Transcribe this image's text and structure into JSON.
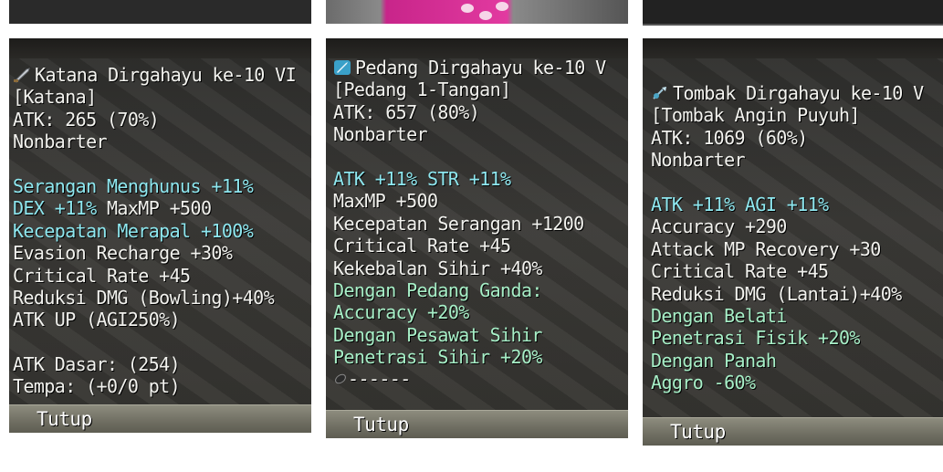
{
  "panels": [
    {
      "title": "Katana Dirgahayu ke-10 VI",
      "title_icon": "katana-icon",
      "lines": [
        {
          "text": "[Katana]",
          "style": "white"
        },
        {
          "text": "ATK: 265 (70%)",
          "style": "white"
        },
        {
          "text": "Nonbarter",
          "style": "white"
        },
        {
          "text": "",
          "style": "blank"
        },
        {
          "text": "Serangan Menghunus +11%",
          "style": "cyan"
        },
        {
          "text": "DEX +11% MaxMP +500",
          "style": "mixed",
          "parts": [
            {
              "text": "DEX +11%",
              "style": "cyan"
            },
            {
              "text": " MaxMP +500",
              "style": "white"
            }
          ]
        },
        {
          "text": "Kecepatan Merapal +100%",
          "style": "cyan"
        },
        {
          "text": "Evasion Recharge +30%",
          "style": "white"
        },
        {
          "text": "Critical Rate +45",
          "style": "white"
        },
        {
          "text": "Reduksi DMG (Bowling)+40%",
          "style": "white"
        },
        {
          "text": "ATK UP (AGI250%)",
          "style": "white"
        },
        {
          "text": "",
          "style": "blank"
        },
        {
          "text": "ATK Dasar: (254)",
          "style": "white"
        },
        {
          "text": "Tempa: (+0/0 pt)",
          "style": "white"
        }
      ],
      "close_label": "Tutup"
    },
    {
      "title": "Pedang Dirgahayu ke-10 V",
      "title_icon": "sword-icon",
      "lines": [
        {
          "text": "[Pedang 1-Tangan]",
          "style": "white"
        },
        {
          "text": "ATK: 657 (80%)",
          "style": "white"
        },
        {
          "text": "Nonbarter",
          "style": "white"
        },
        {
          "text": "",
          "style": "blank"
        },
        {
          "text": "ATK +11% STR +11%",
          "style": "cyan"
        },
        {
          "text": "MaxMP +500",
          "style": "white"
        },
        {
          "text": "Kecepatan Serangan +1200",
          "style": "white"
        },
        {
          "text": "Critical Rate +45",
          "style": "white"
        },
        {
          "text": "Kekebalan Sihir +40%",
          "style": "white"
        },
        {
          "text": "Dengan Pedang Ganda:",
          "style": "green"
        },
        {
          "text": "Accuracy +20%",
          "style": "green"
        },
        {
          "text": "Dengan Pesawat Sihir",
          "style": "green"
        },
        {
          "text": "Penetrasi Sihir +20%",
          "style": "green"
        },
        {
          "text": "------",
          "style": "white",
          "icon": "bean-icon"
        }
      ],
      "close_label": "Tutup"
    },
    {
      "title": "Tombak Dirgahayu ke-10 V",
      "title_icon": "spear-icon",
      "lines": [
        {
          "text": "[Tombak Angin Puyuh]",
          "style": "white"
        },
        {
          "text": "ATK: 1069 (60%)",
          "style": "white"
        },
        {
          "text": "Nonbarter",
          "style": "white"
        },
        {
          "text": "",
          "style": "blank"
        },
        {
          "text": "ATK +11% AGI +11%",
          "style": "cyan"
        },
        {
          "text": "Accuracy +290",
          "style": "white"
        },
        {
          "text": "Attack MP Recovery +30",
          "style": "white"
        },
        {
          "text": "Critical Rate +45",
          "style": "white"
        },
        {
          "text": "Reduksi DMG (Lantai)+40%",
          "style": "white"
        },
        {
          "text": "Dengan Belati",
          "style": "green"
        },
        {
          "text": "Penetrasi Fisik +20%",
          "style": "green"
        },
        {
          "text": "Dengan Panah",
          "style": "green"
        },
        {
          "text": "Aggro -60%",
          "style": "green"
        }
      ],
      "close_label": "Tutup"
    }
  ]
}
